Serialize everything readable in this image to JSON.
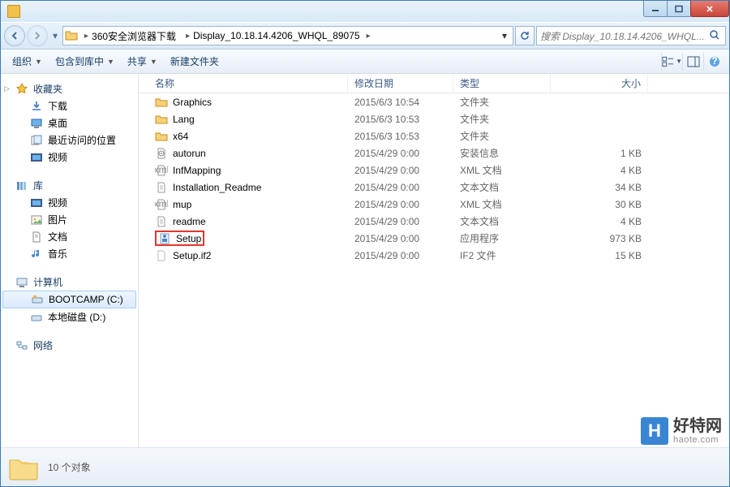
{
  "titlebar": {
    "title": ""
  },
  "breadcrumbs": [
    "360安全浏览器下载",
    "Display_10.18.14.4206_WHQL_89075"
  ],
  "search": {
    "placeholder": "搜索 Display_10.18.14.4206_WHQL..."
  },
  "toolbar": {
    "organize": "组织",
    "include": "包含到库中",
    "share": "共享",
    "new_folder": "新建文件夹"
  },
  "columns": {
    "name": "名称",
    "modified": "修改日期",
    "type": "类型",
    "size": "大小"
  },
  "sidebar": {
    "favorites": {
      "label": "收藏夹",
      "items": [
        "下载",
        "桌面",
        "最近访问的位置",
        "视频"
      ]
    },
    "libraries": {
      "label": "库",
      "items": [
        "视频",
        "图片",
        "文档",
        "音乐"
      ]
    },
    "computer": {
      "label": "计算机",
      "items": [
        "BOOTCAMP (C:)",
        "本地磁盘 (D:)"
      ]
    },
    "network": {
      "label": "网络"
    }
  },
  "files": [
    {
      "name": "Graphics",
      "modified": "2015/6/3 10:54",
      "type": "文件夹",
      "size": "",
      "icon": "folder"
    },
    {
      "name": "Lang",
      "modified": "2015/6/3 10:53",
      "type": "文件夹",
      "size": "",
      "icon": "folder"
    },
    {
      "name": "x64",
      "modified": "2015/6/3 10:53",
      "type": "文件夹",
      "size": "",
      "icon": "folder"
    },
    {
      "name": "autorun",
      "modified": "2015/4/29 0:00",
      "type": "安装信息",
      "size": "1 KB",
      "icon": "inf"
    },
    {
      "name": "InfMapping",
      "modified": "2015/4/29 0:00",
      "type": "XML 文档",
      "size": "4 KB",
      "icon": "xml"
    },
    {
      "name": "Installation_Readme",
      "modified": "2015/4/29 0:00",
      "type": "文本文档",
      "size": "34 KB",
      "icon": "txt"
    },
    {
      "name": "mup",
      "modified": "2015/4/29 0:00",
      "type": "XML 文档",
      "size": "30 KB",
      "icon": "xml"
    },
    {
      "name": "readme",
      "modified": "2015/4/29 0:00",
      "type": "文本文档",
      "size": "4 KB",
      "icon": "txt"
    },
    {
      "name": "Setup",
      "modified": "2015/4/29 0:00",
      "type": "应用程序",
      "size": "973 KB",
      "icon": "exe",
      "highlighted": true
    },
    {
      "name": "Setup.if2",
      "modified": "2015/4/29 0:00",
      "type": "IF2 文件",
      "size": "15 KB",
      "icon": "file"
    }
  ],
  "status": {
    "count_label": "10 个对象"
  },
  "watermark": {
    "badge": "H",
    "line1": "好特网",
    "line2": "haote.com"
  }
}
